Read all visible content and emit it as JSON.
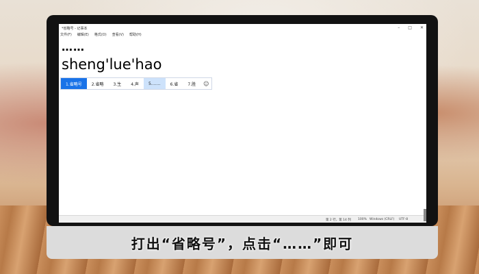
{
  "window": {
    "title": "*省略号 - 记事本",
    "minimize": "–",
    "maximize": "□",
    "close": "✕"
  },
  "menu": [
    "文件(F)",
    "编辑(E)",
    "格式(O)",
    "查看(V)",
    "帮助(H)"
  ],
  "editor": {
    "line1": "……",
    "line2": "sheng'lue'hao"
  },
  "ime": {
    "candidates": [
      {
        "label": "1.省略号"
      },
      {
        "label": "2.省略"
      },
      {
        "label": "3.生"
      },
      {
        "label": "4.声"
      },
      {
        "label": "5.……"
      },
      {
        "label": "6.省"
      },
      {
        "label": "7.胜"
      }
    ],
    "emoji_icon": "☺"
  },
  "status": {
    "position": "第 2 行，第 14 列",
    "zoom": "100%",
    "line_ending": "Windows (CRLF)",
    "encoding": "UTF-8"
  },
  "caption": "打出“省略号”，点击“……”即可"
}
